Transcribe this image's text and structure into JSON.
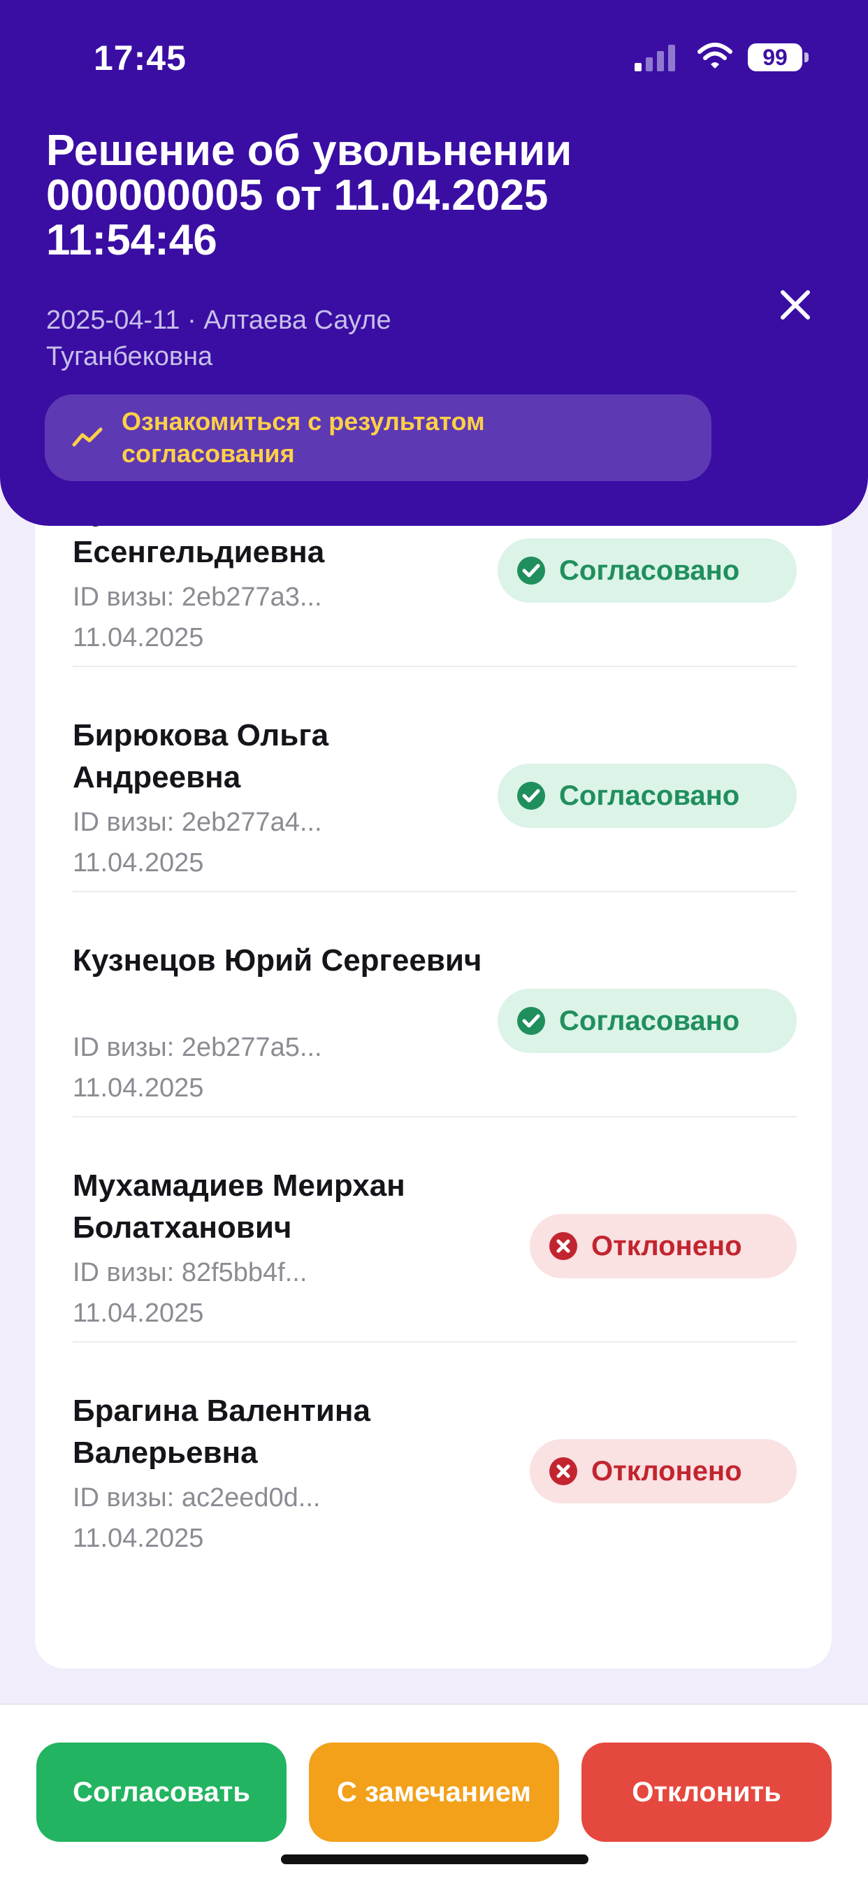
{
  "status_bar": {
    "time": "17:45",
    "battery": "99"
  },
  "header": {
    "title": "Решение об увольнении 000000005 от 11.04.2025 11:54:46",
    "subtitle": "2025-04-11 · Алтаева Сауле Туганбековна",
    "result_button_label": "Ознакомиться с результатом согласования",
    "colors": {
      "background": "#3a0ea3",
      "result_text": "#ffd048"
    }
  },
  "approvals": [
    {
      "name": "Кустанова Алия Есенгельдиевна",
      "visa_id": "ID визы: 2eb277a3...",
      "date": "11.04.2025",
      "status": "Согласовано",
      "status_type": "approved"
    },
    {
      "name": "Бирюкова  Ольга Андреевна",
      "visa_id": "ID визы: 2eb277a4...",
      "date": "11.04.2025",
      "status": "Согласовано",
      "status_type": "approved"
    },
    {
      "name": "Кузнецов Юрий Сергеевич",
      "visa_id": "ID визы: 2eb277a5...",
      "date": "11.04.2025",
      "status": "Согласовано",
      "status_type": "approved"
    },
    {
      "name": "Мухамадиев Меирхан Болатханович",
      "visa_id": "ID визы: 82f5bb4f...",
      "date": "11.04.2025",
      "status": "Отклонено",
      "status_type": "rejected"
    },
    {
      "name": "Брагина Валентина Валерьевна",
      "visa_id": "ID визы: ac2eed0d...",
      "date": "11.04.2025",
      "status": "Отклонено",
      "status_type": "rejected"
    }
  ],
  "actions": {
    "approve": "Согласовать",
    "approve_with_remark": "С замечанием",
    "reject": "Отклонить",
    "colors": {
      "approve": "#22b460",
      "remark": "#f3a01a",
      "reject": "#e5483e"
    }
  },
  "icons": {
    "close": "close-icon",
    "result": "trend-line-icon",
    "approved": "check-circle-icon",
    "rejected": "x-circle-icon"
  }
}
